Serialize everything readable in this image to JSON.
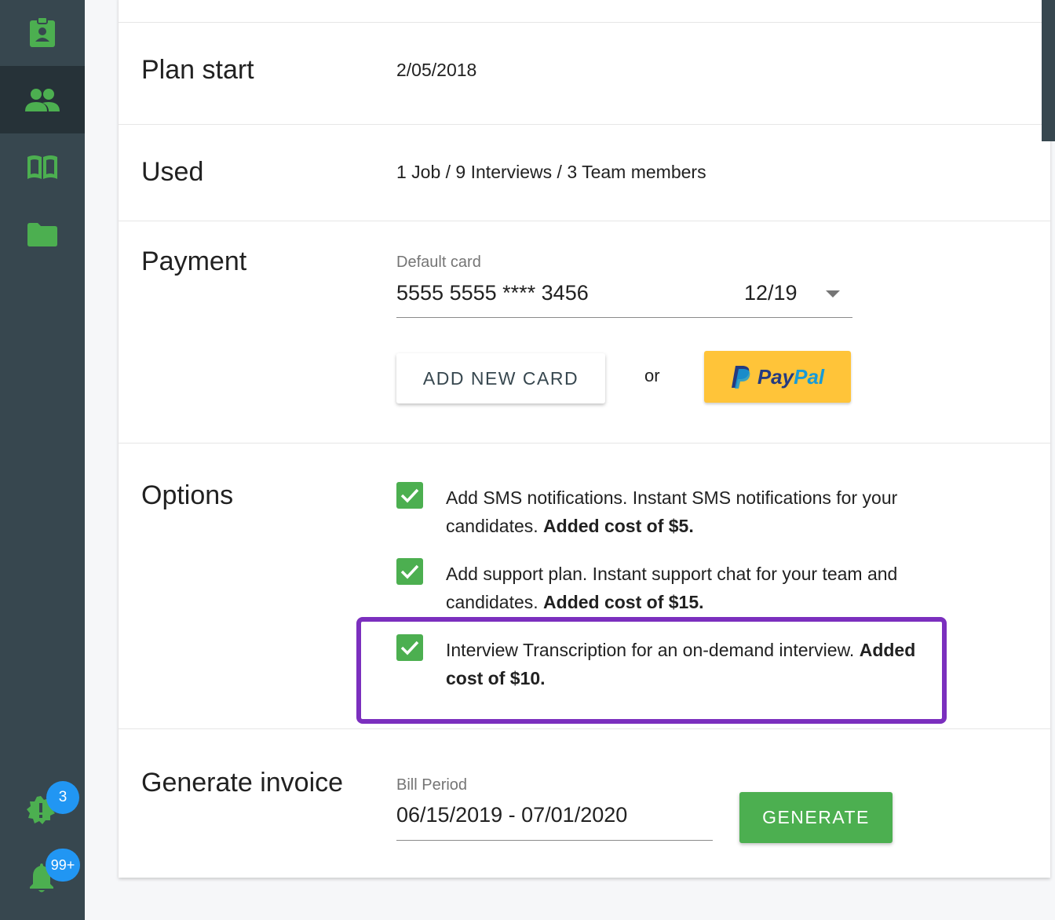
{
  "sidebar": {
    "items": [
      {
        "icon": "id-badge-icon",
        "active": false
      },
      {
        "icon": "team-icon",
        "active": true
      },
      {
        "icon": "book-icon",
        "active": false
      },
      {
        "icon": "folder-icon",
        "active": false
      }
    ],
    "alerts_badge": "3",
    "notifications_badge": "99+"
  },
  "plan_start": {
    "label": "Plan start",
    "value": "2/05/2018"
  },
  "used": {
    "label": "Used",
    "value": "1 Job / 9 Interviews / 3 Team members"
  },
  "payment": {
    "label": "Payment",
    "card_caption": "Default card",
    "card_number": "5555 5555 **** 3456",
    "card_expiry": "12/19",
    "add_card_button": "ADD NEW CARD",
    "or_text": "or",
    "paypal": {
      "pay": "Pay",
      "pal": "Pal"
    }
  },
  "options": {
    "label": "Options",
    "items": [
      {
        "text": "Add SMS notifications. Instant SMS notifications for your candidates.",
        "cost": "Added cost of $5.",
        "checked": true
      },
      {
        "text": "Add support plan. Instant support chat for your team and candidates.",
        "cost": "Added cost of $15.",
        "checked": true
      },
      {
        "text": "Interview Transcription for an on-demand interview.",
        "cost": "Added cost of $10.",
        "checked": true
      }
    ]
  },
  "invoice": {
    "label": "Generate invoice",
    "period_caption": "Bill Period",
    "period_value": "06/15/2019 - 07/01/2020",
    "generate_button": "GENERATE"
  },
  "colors": {
    "sidebar": "#37474f",
    "accent_green": "#4caf50",
    "highlight_purple": "#7b2fbe",
    "badge_blue": "#2196f3",
    "paypal_yellow": "#ffc439"
  }
}
